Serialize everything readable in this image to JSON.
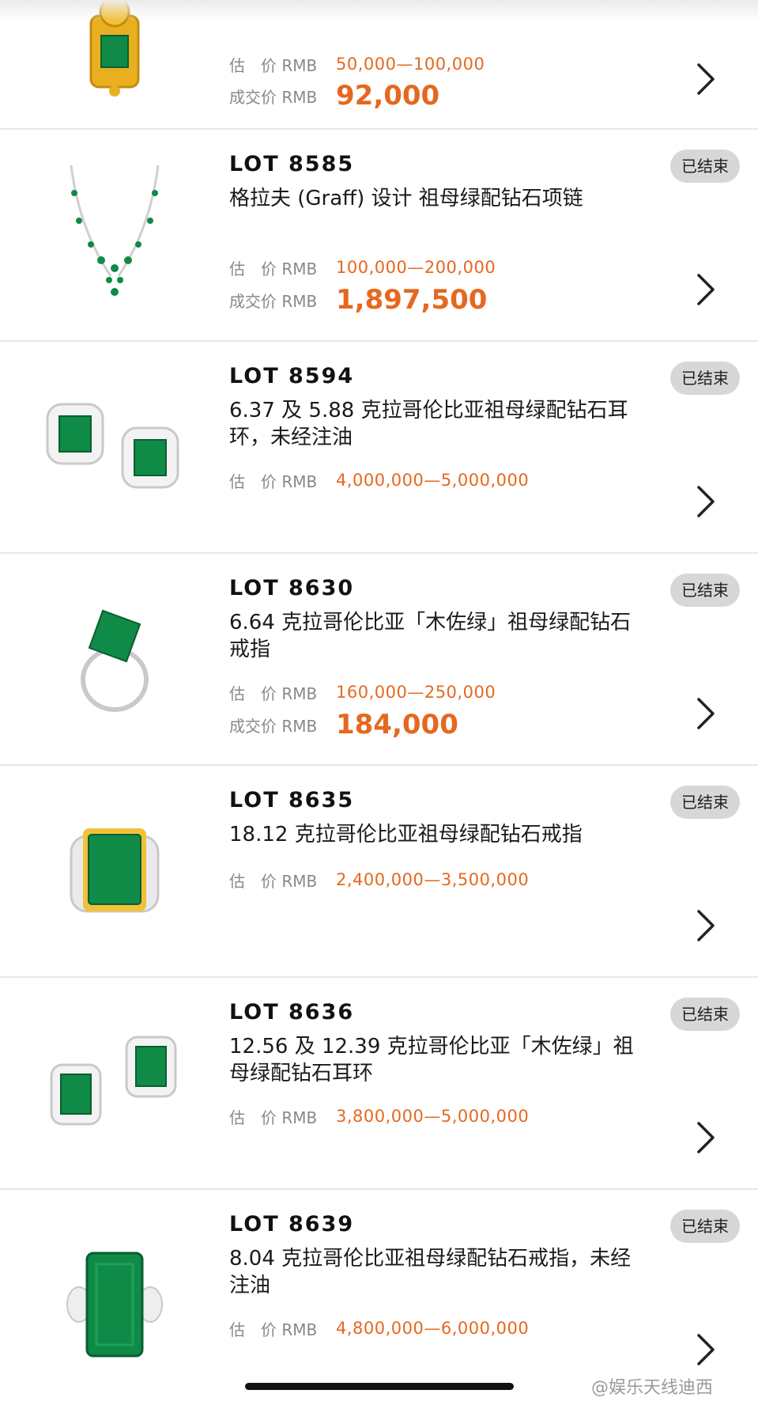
{
  "status_label": "已结束",
  "est_label": "估　价 RMB",
  "sold_label": "成交价 RMB",
  "watermark": "@娱乐天线迪西",
  "top_item": {
    "estimate": "50,000—100,000",
    "sold": "92,000",
    "icon": "emerald-pendant-icon"
  },
  "lots": [
    {
      "lot": "LOT 8585",
      "title": "格拉夫 (Graff) 设计 祖母绿配钻石项链",
      "estimate": "100,000—200,000",
      "sold": "1,897,500",
      "icon": "emerald-necklace-icon"
    },
    {
      "lot": "LOT 8594",
      "title": "6.37 及 5.88 克拉哥伦比亚祖母绿配钻石耳环，未经注油",
      "estimate": "4,000,000—5,000,000",
      "icon": "emerald-earrings-icon"
    },
    {
      "lot": "LOT 8630",
      "title": "6.64 克拉哥伦比亚「木佐绿」祖母绿配钻石戒指",
      "estimate": "160,000—250,000",
      "sold": "184,000",
      "icon": "emerald-ring-icon"
    },
    {
      "lot": "LOT 8635",
      "title": "18.12 克拉哥伦比亚祖母绿配钻石戒指",
      "estimate": "2,400,000—3,500,000",
      "icon": "emerald-ring-icon"
    },
    {
      "lot": "LOT 8636",
      "title": "12.56 及 12.39 克拉哥伦比亚「木佐绿」祖母绿配钻石耳环",
      "estimate": "3,800,000—5,000,000",
      "icon": "emerald-earrings-icon"
    },
    {
      "lot": "LOT 8639",
      "title": "8.04 克拉哥伦比亚祖母绿配钻石戒指，未经注油",
      "estimate": "4,800,000—6,000,000",
      "icon": "emerald-ring-icon"
    }
  ],
  "colors": {
    "price": "#e5681f",
    "badge_bg": "#d7d7d7",
    "emerald": "#0f8a47"
  }
}
